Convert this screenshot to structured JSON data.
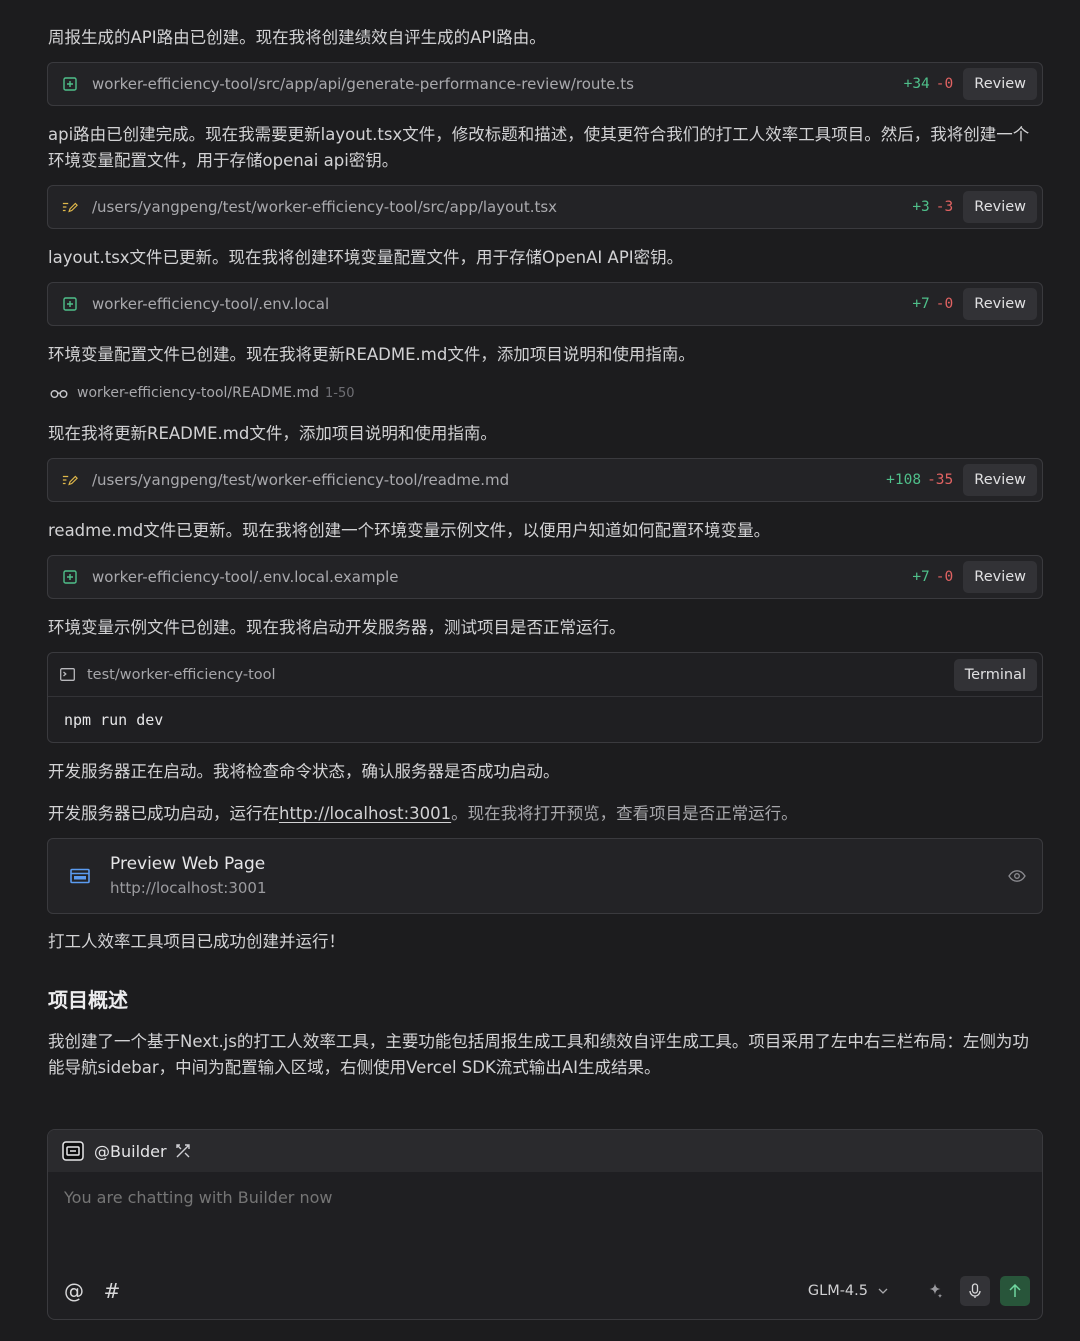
{
  "messages": {
    "m1": "周报生成的API路由已创建。现在我将创建绩效自评生成的API路由。",
    "m2": "api路由已创建完成。现在我需要更新layout.tsx文件，修改标题和描述，使其更符合我们的打工人效率工具项目。然后，我将创建一个环境变量配置文件，用于存储openai api密钥。",
    "m3": "layout.tsx文件已更新。现在我将创建环境变量配置文件，用于存储OpenAI API密钥。",
    "m4": "环境变量配置文件已创建。现在我将更新README.md文件，添加项目说明和使用指南。",
    "m5": "现在我将更新README.md文件，添加项目说明和使用指南。",
    "m6": "readme.md文件已更新。现在我将创建一个环境变量示例文件，以便用户知道如何配置环境变量。",
    "m7": "环境变量示例文件已创建。现在我将启动开发服务器，测试项目是否正常运行。",
    "m8": "开发服务器正在启动。我将检查命令状态，确认服务器是否成功启动。",
    "m9_pre": "开发服务器已成功启动，运行在",
    "m9_link": "http://localhost:3001",
    "m9_post": "。现在我将打开预览，查看项目是否正常运行。",
    "m10": "打工人效率工具项目已成功创建并运行！",
    "m11": "我创建了一个基于Next.js的打工人效率工具，主要功能包括周报生成工具和绩效自评生成工具。项目采用了左中右三栏布局：左侧为功能导航sidebar，中间为配置输入区域，右侧使用Vercel SDK流式输出AI生成结果。"
  },
  "files": [
    {
      "icon": "file-add-icon",
      "path": "worker-efficiency-tool/src/app/api/generate-performance-review/route.ts",
      "added": "+34",
      "removed": "-0",
      "review": "Review"
    },
    {
      "icon": "file-edit-icon",
      "path": "/users/yangpeng/test/worker-efficiency-tool/src/app/layout.tsx",
      "added": "+3",
      "removed": "-3",
      "review": "Review"
    },
    {
      "icon": "file-add-icon",
      "path": "worker-efficiency-tool/.env.local",
      "added": "+7",
      "removed": "-0",
      "review": "Review"
    },
    {
      "icon": "file-edit-icon",
      "path": "/users/yangpeng/test/worker-efficiency-tool/readme.md",
      "added": "+108",
      "removed": "-35",
      "review": "Review"
    },
    {
      "icon": "file-add-icon",
      "path": "worker-efficiency-tool/.env.local.example",
      "added": "+7",
      "removed": "-0",
      "review": "Review"
    }
  ],
  "read": {
    "icon": "glasses-icon",
    "path": "worker-efficiency-tool/README.md",
    "range": "1-50"
  },
  "terminal": {
    "path": "test/worker-efficiency-tool",
    "button": "Terminal",
    "command": "npm run dev"
  },
  "preview": {
    "title": "Preview Web Page",
    "url": "http://localhost:3001"
  },
  "heading": "项目概述",
  "composer": {
    "agent": "@Builder",
    "placeholder": "You are chatting with Builder now",
    "at_symbol": "@",
    "hash_symbol": "#",
    "model": "GLM-4.5"
  },
  "colors": {
    "background": "#1c1c1e",
    "added": "#4fbf8a",
    "removed": "#e06262",
    "send": "#28553a"
  }
}
